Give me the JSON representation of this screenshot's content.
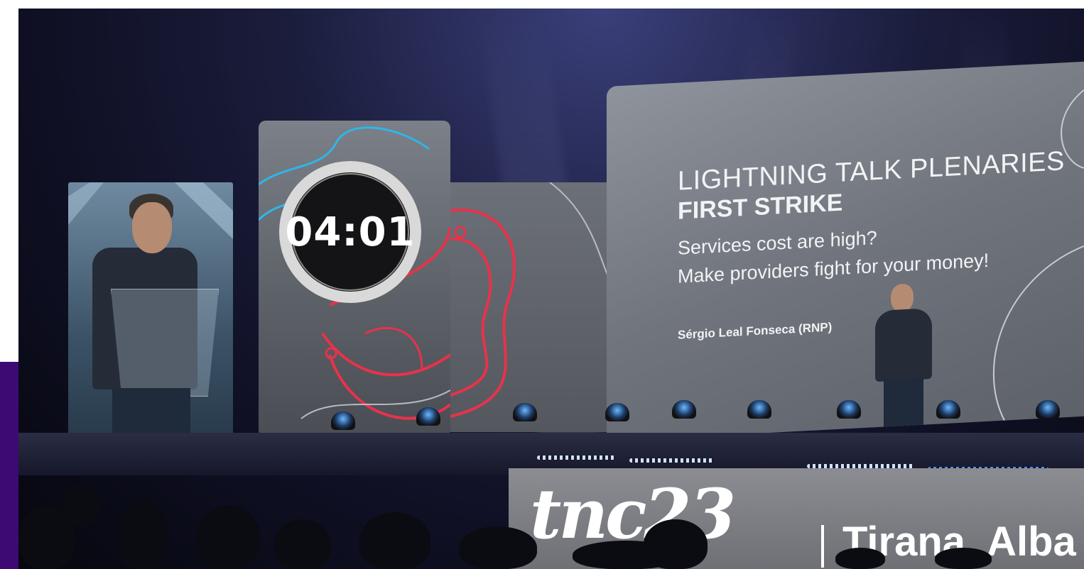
{
  "timer": {
    "display": "04:01"
  },
  "slide": {
    "title": "LIGHTNING TALK PLENARIES",
    "subtitle": "FIRST STRIKE",
    "line1": "Services cost are high?",
    "line2": "Make providers fight for your money!",
    "speaker": "Sérgio Leal Fonseca (RNP)"
  },
  "banner": {
    "logo": "tnc23",
    "city": "Tirana, Alba"
  },
  "colors": {
    "contour_red": "#e8324b",
    "contour_blue": "#2fb6e8",
    "timer_ring": "#d9d9d9",
    "purple_edge": "#3d0a73"
  }
}
